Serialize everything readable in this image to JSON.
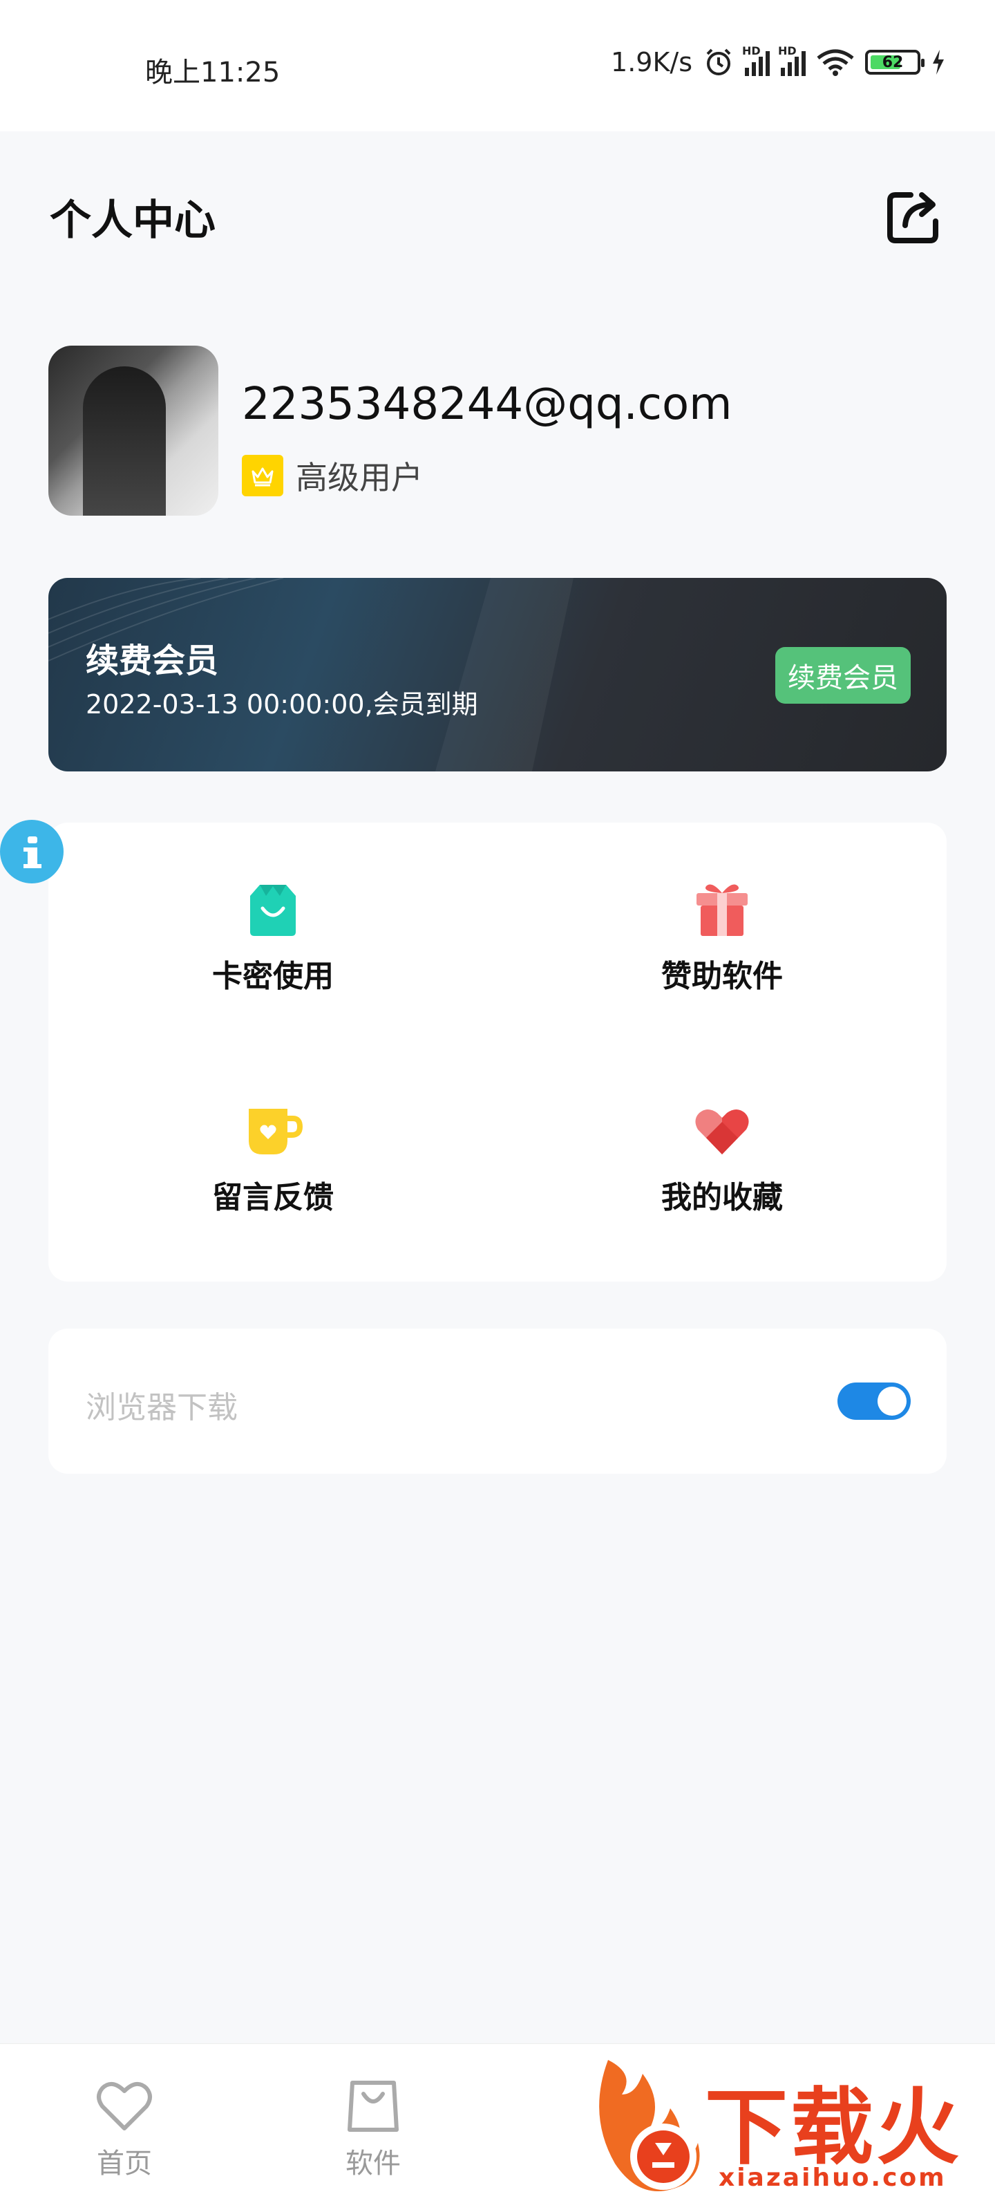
{
  "status_bar": {
    "time": "晚上11:25",
    "net_speed": "1.9K/s",
    "hd1": "HD",
    "hd2": "HD",
    "battery": "62"
  },
  "header": {
    "title": "个人中心"
  },
  "profile": {
    "email": "2235348244@qq.com",
    "level": "高级用户"
  },
  "vip": {
    "title": "续费会员",
    "expire": "2022-03-13 00:00:00,会员到期",
    "button": "续费会员"
  },
  "grid": {
    "items": [
      {
        "label": "卡密使用",
        "icon": "shopping-bag-icon"
      },
      {
        "label": "赞助软件",
        "icon": "gift-icon"
      },
      {
        "label": "留言反馈",
        "icon": "cup-icon"
      },
      {
        "label": "我的收藏",
        "icon": "heart-icon"
      }
    ]
  },
  "settings": {
    "browser_download": "浏览器下载",
    "browser_download_on": true
  },
  "bottom_nav": {
    "items": [
      {
        "label": "首页",
        "icon": "heart-outline-icon"
      },
      {
        "label": "软件",
        "icon": "bag-outline-icon"
      }
    ]
  },
  "watermark": {
    "text": "下载火",
    "url": "xiazaihuo.com"
  },
  "colors": {
    "accent_blue": "#1e88e5",
    "vip_button": "#55c27a",
    "crown_yellow": "#ffd400",
    "bag_teal": "#1fd1b5",
    "gift_red": "#f05c5c",
    "cup_yellow": "#fcd12a",
    "heart_red": "#e84545"
  }
}
